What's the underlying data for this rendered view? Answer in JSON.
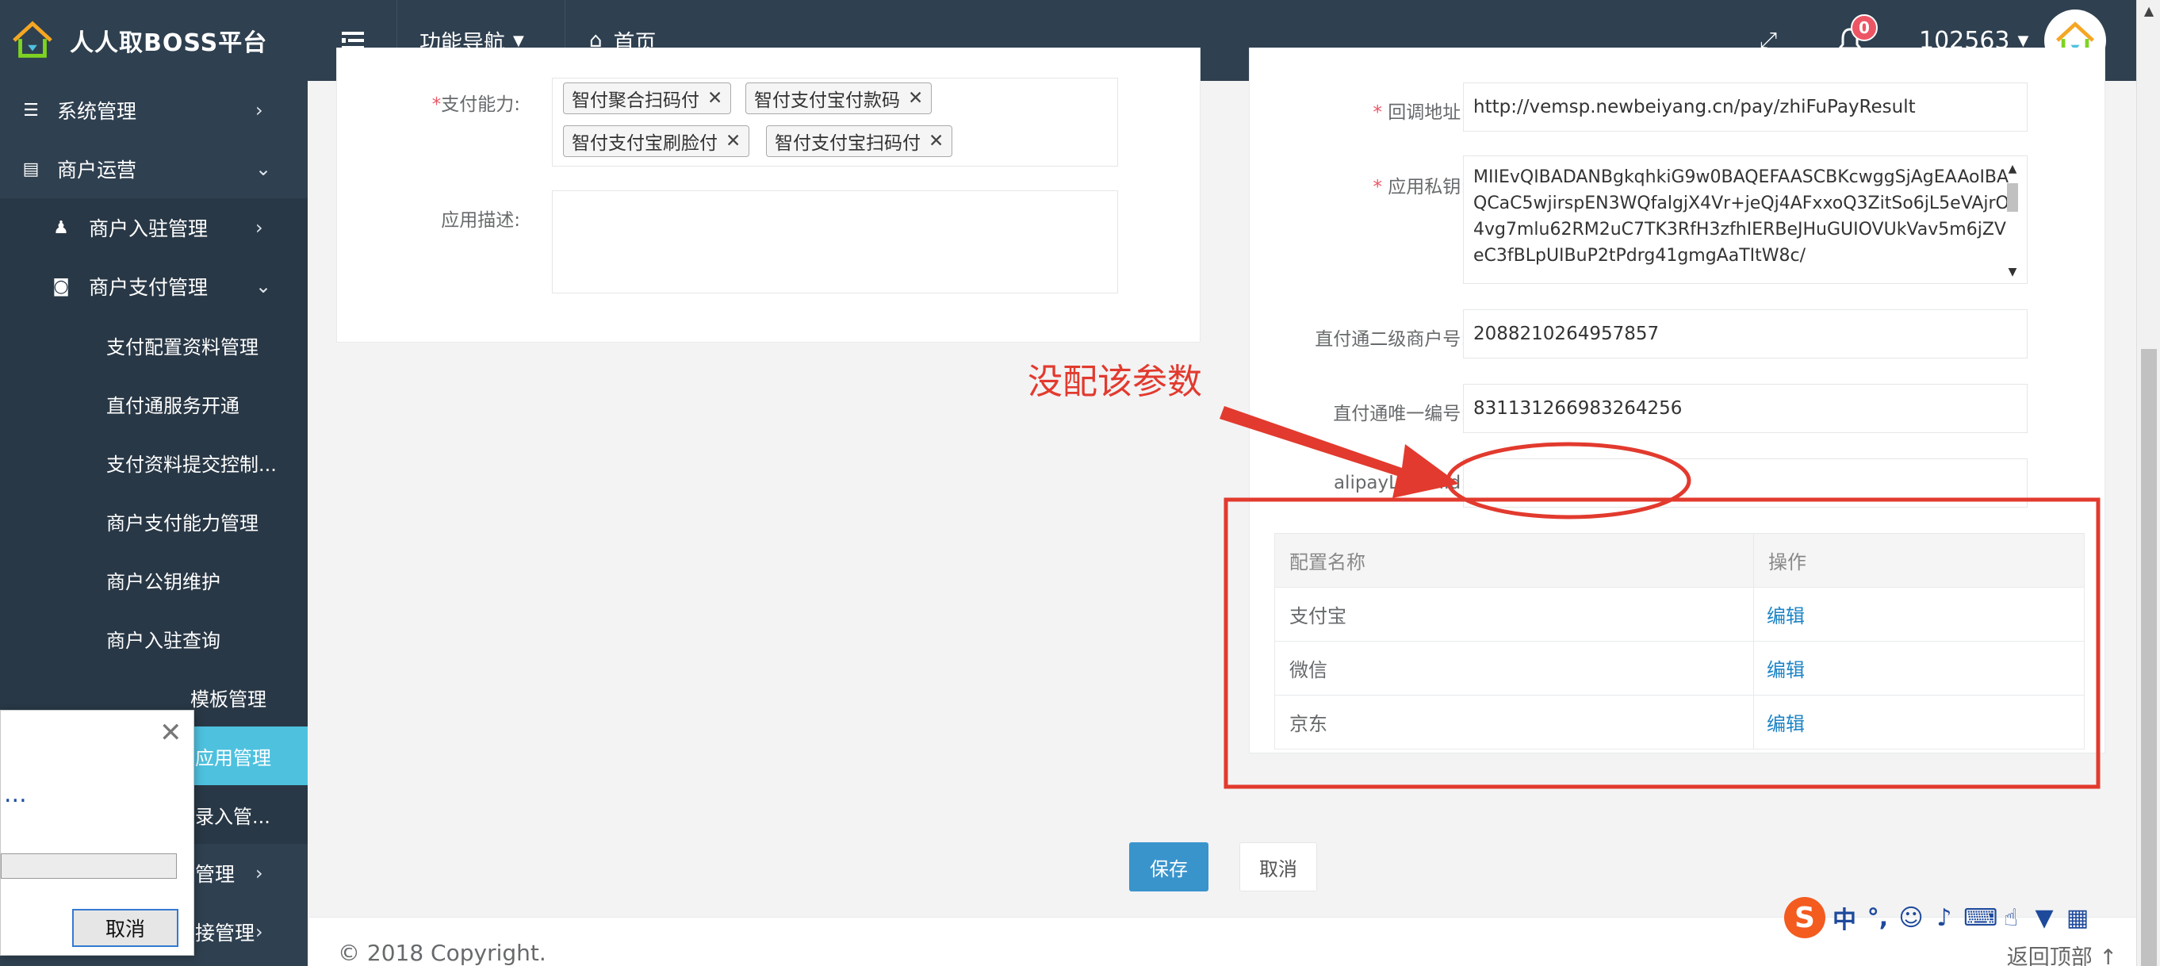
{
  "app": {
    "brand": "人人取BOSS平台"
  },
  "topbar": {
    "func_nav": "功能导航",
    "home": "首页",
    "notification_count": "0",
    "user_id": "102563"
  },
  "sidebar": {
    "items": [
      {
        "label": "系统管理"
      },
      {
        "label": "商户运营"
      },
      {
        "label": "商户入驻管理"
      },
      {
        "label": "商户支付管理"
      }
    ],
    "leaves": [
      "支付配置资料管理",
      "直付通服务开通",
      "支付资料提交控制...",
      "商户支付能力管理",
      "商户公钥维护",
      "商户入驻查询",
      "模板管理",
      "应用管理",
      "录入管...",
      "管理",
      "接管理"
    ]
  },
  "form_left": {
    "pay_ability_label": "支付能力:",
    "pay_ability_tags": [
      "智付聚合扫码付",
      "智付支付宝付款码",
      "智付支付宝刷脸付",
      "智付支付宝扫码付"
    ],
    "app_desc_label": "应用描述:",
    "app_desc_value": ""
  },
  "form_right": {
    "callback_label": "回调地址:",
    "callback_value": "http://vemsp.newbeiyang.cn/pay/zhiFuPayResult",
    "private_key_label": "应用私钥:",
    "private_key_value": "MIIEvQIBADANBgkqhkiG9w0BAQEFAASCBKcwggSjAgEAAoIBAQCaC5wjirspEN3WQfalgjX4Vr+jeQj4AFxxoQ3ZitSo6jL5eVAjrO4vg7mlu62RM2uC7TK3RfH3zfhIERBeJHuGUIOVUkVav5m6jZVeC3fBLpUIBuP2tPdrg41gmgAaTItW8c/",
    "secondary_merchant_label": "直付通二级商户号:",
    "secondary_merchant_value": "2088210264957857",
    "unique_no_label": "直付通唯一编号:",
    "unique_no_value": "831131266983264256",
    "alipay_logon_label": "alipayLogonId:",
    "alipay_logon_value": ""
  },
  "annotation": {
    "note": "没配该参数"
  },
  "config_table": {
    "headers": [
      "配置名称",
      "操作"
    ],
    "rows": [
      {
        "name": "支付宝",
        "action": "编辑"
      },
      {
        "name": "微信",
        "action": "编辑"
      },
      {
        "name": "京东",
        "action": "编辑"
      }
    ]
  },
  "actions": {
    "save": "保存",
    "cancel": "取消"
  },
  "footer": {
    "copyright": "© 2018 Copyright.",
    "back_to_top": "返回顶部"
  },
  "dialog": {
    "message": "...",
    "cancel": "取消"
  },
  "ime": {
    "mode": "中",
    "punct": "°,"
  },
  "colors": {
    "accent": "#1ab394",
    "sidebar_bg": "#2f4050",
    "active_item": "#4ec1df",
    "annotation_red": "#e23a2e",
    "link_blue": "#1c84c6"
  }
}
